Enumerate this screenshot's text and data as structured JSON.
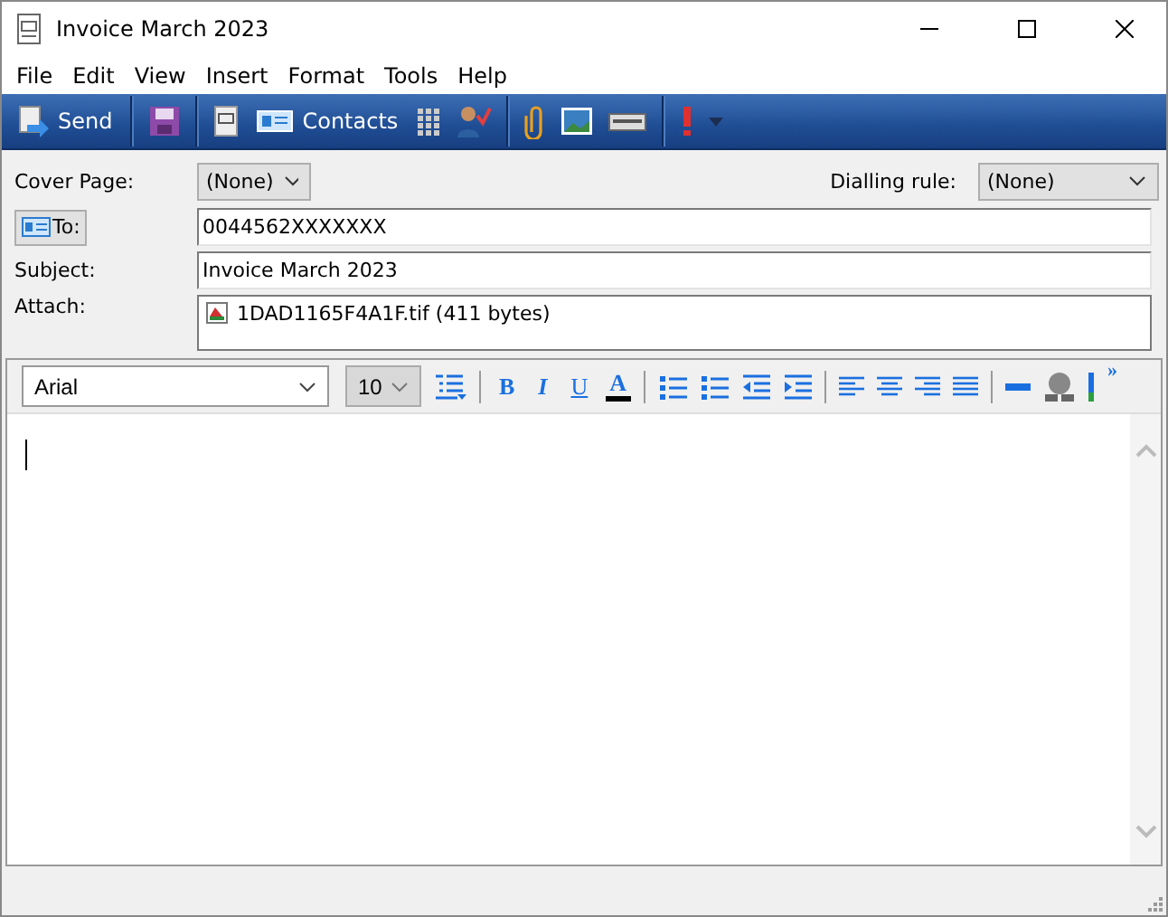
{
  "window": {
    "title": "Invoice March 2023"
  },
  "menu": [
    "File",
    "Edit",
    "View",
    "Insert",
    "Format",
    "Tools",
    "Help"
  ],
  "toolbar": [
    {
      "kind": "send",
      "label": "Send"
    },
    {
      "kind": "sep"
    },
    {
      "kind": "save"
    },
    {
      "kind": "sep"
    },
    {
      "kind": "page"
    },
    {
      "kind": "contacts",
      "label": "Contacts"
    },
    {
      "kind": "grid"
    },
    {
      "kind": "person"
    },
    {
      "kind": "sep"
    },
    {
      "kind": "clip"
    },
    {
      "kind": "image"
    },
    {
      "kind": "scanner"
    },
    {
      "kind": "sep"
    },
    {
      "kind": "priority"
    },
    {
      "kind": "dropdown"
    }
  ],
  "form": {
    "cover_page": {
      "label": "Cover Page:",
      "value": "(None)"
    },
    "dialling_rule": {
      "label": "Dialling rule:",
      "value": "(None)"
    },
    "to": {
      "label": "To:",
      "value": "0044562XXXXXXX"
    },
    "subject": {
      "label": "Subject:",
      "value": "Invoice March 2023"
    },
    "attach": {
      "label": "Attach:",
      "file": "1DAD1165F4A1F.tif (411 bytes)"
    }
  },
  "format_bar": {
    "font": "Arial",
    "size": "10",
    "buttons": [
      {
        "kind": "outline"
      },
      {
        "kind": "sep"
      },
      {
        "kind": "text",
        "label": "B"
      },
      {
        "kind": "text",
        "label": "I"
      },
      {
        "kind": "text",
        "label": "U"
      },
      {
        "kind": "text",
        "label": "A"
      },
      {
        "kind": "sep"
      },
      {
        "kind": "numbered"
      },
      {
        "kind": "bullets"
      },
      {
        "kind": "outdent"
      },
      {
        "kind": "indent"
      },
      {
        "kind": "sep"
      },
      {
        "kind": "left"
      },
      {
        "kind": "center"
      },
      {
        "kind": "right"
      },
      {
        "kind": "justify"
      },
      {
        "kind": "sep"
      },
      {
        "kind": "rule"
      },
      {
        "kind": "network"
      },
      {
        "kind": "bar"
      },
      {
        "kind": "more",
        "label": "»"
      }
    ]
  }
}
